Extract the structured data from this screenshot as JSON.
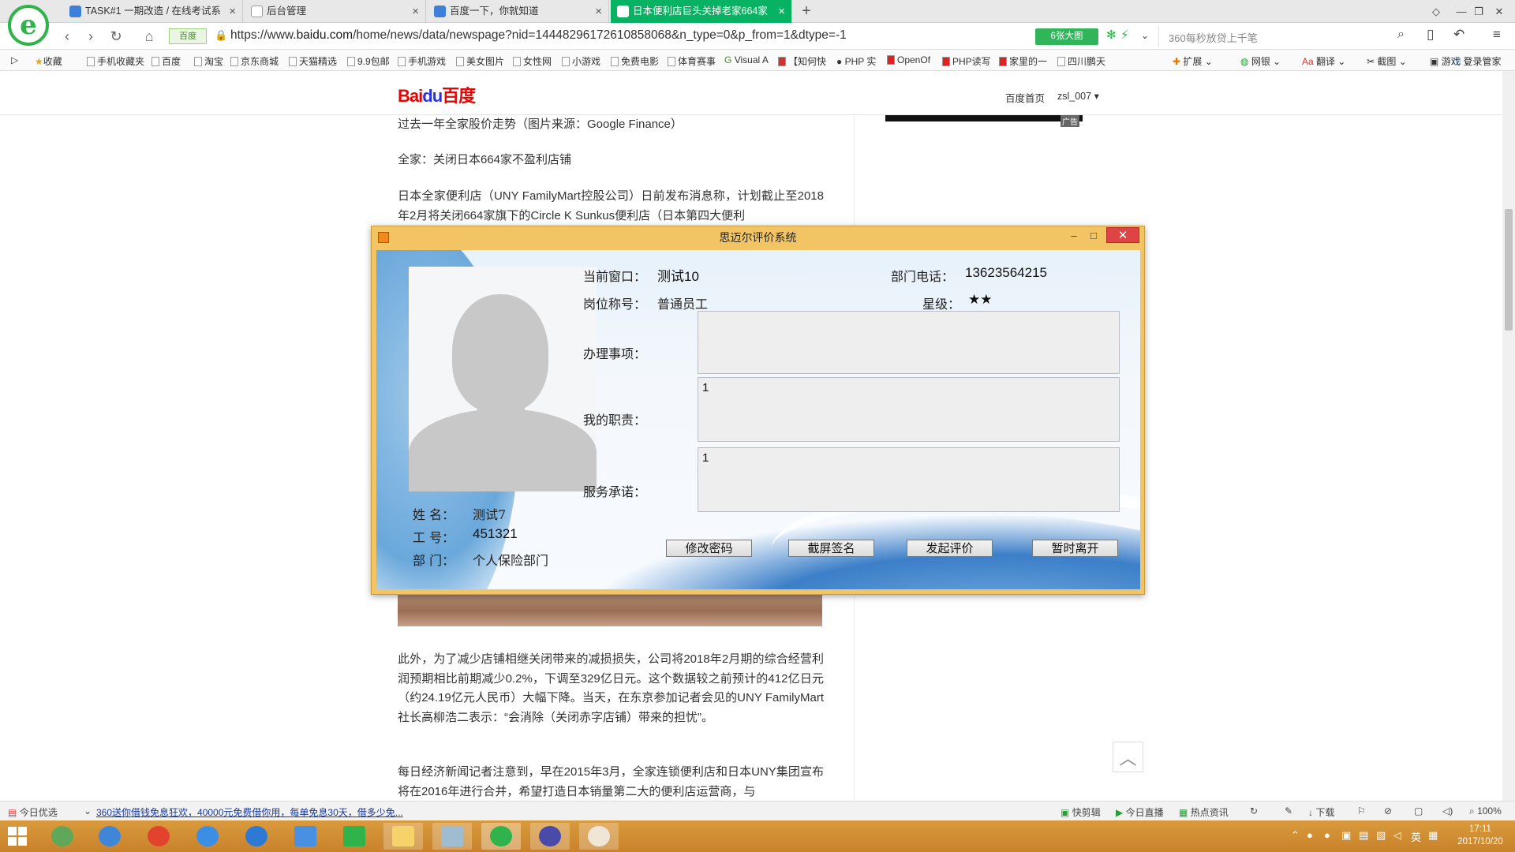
{
  "browser": {
    "tabs": [
      {
        "title": "TASK#1 一期改造 / 在线考试系"
      },
      {
        "title": "后台管理"
      },
      {
        "title": "百度一下，你就知道"
      },
      {
        "title": "日本便利店巨头关掉老家664家"
      }
    ],
    "badge": "百度",
    "url_prefix": "https://www.",
    "url_domain": "baidu.com",
    "url_rest": "/home/news/data/newspage?nid=14448296172610858068&n_type=0&p_from=1&dtype=-1",
    "big_image_btn": "6张大图",
    "search_placeholder": "360每秒放贷上千笔",
    "bookmarks": [
      "收藏",
      "手机收藏夹",
      "百度",
      "淘宝",
      "京东商城",
      "天猫精选",
      "9.9包邮",
      "手机游戏",
      "美女图片",
      "女性网",
      "小游戏",
      "免费电影",
      "体育赛事",
      "Visual A",
      "【知何快",
      "PHP 实",
      "OpenOf",
      "PHP读写",
      "家里的一",
      "四川鹏天"
    ],
    "right_tools": [
      "扩展",
      "网银",
      "翻译",
      "截图",
      "游戏",
      "登录管家"
    ]
  },
  "page": {
    "logo_a": "Bai",
    "logo_b": "du",
    "logo_c": "百度",
    "nav_home": "百度首页",
    "user": "zsl_007",
    "ad_label": "广告",
    "paragraphs": [
      "过去一年全家股价走势（图片来源：Google Finance）",
      "全家：关闭日本664家不盈利店铺",
      "日本全家便利店（UNY FamilyMart控股公司）日前发布消息称，计划截止至2018年2月将关闭664家旗下的Circle K Sunkus便利店（日本第四大便利"
    ],
    "paragraphs_lower": [
      "此外，为了减少店铺相继关闭带来的减损损失，公司将2018年2月期的综合经营利润预期相比前期减少0.2%，下调至329亿日元。这个数据较之前预计的412亿日元（约24.19亿元人民币）大幅下降。当天，在东京参加记者会见的UNY FamilyMart社长高柳浩二表示：“会消除（关闭赤字店铺）带来的担忧”。",
      "每日经济新闻记者注意到，早在2015年3月，全家连锁便利店和日本UNY集团宣布将在2016年进行合并，希望打造日本销量第二大的便利店运营商，与"
    ]
  },
  "statusbar": {
    "left": "今日优选",
    "ticker": "360送你借钱免息狂欢，40000元免费借你用，每单免息30天，借多少免...",
    "items": [
      "快剪辑",
      "今日直播",
      "热点资讯",
      "下载",
      "100%"
    ]
  },
  "taskbar": {
    "time": "17:11",
    "date": "2017/10/20",
    "ime": "英"
  },
  "dialog": {
    "title": "思迈尔评价系统",
    "window_label": "当前窗口：",
    "window_value": "测试10",
    "phone_label": "部门电话：",
    "phone_value": "13623564215",
    "position_label": "岗位称号：",
    "position_value": "普通员工",
    "star_label": "星级：",
    "star_value": "★★",
    "stars": 2,
    "matters_label": "办理事项：",
    "matters_value": "",
    "duty_label": "我的职责：",
    "duty_value": "1",
    "promise_label": "服务承诺：",
    "promise_value": "1",
    "name_label": "姓  名：",
    "name_value": "测试7",
    "id_label": "工  号：",
    "id_value": "451321",
    "dept_label": "部  门：",
    "dept_value": "个人保险部门",
    "buttons": {
      "change_password": "修改密码",
      "screenshot_sign": "截屏签名",
      "start_rating": "发起评价",
      "leave": "暂时离开"
    }
  }
}
